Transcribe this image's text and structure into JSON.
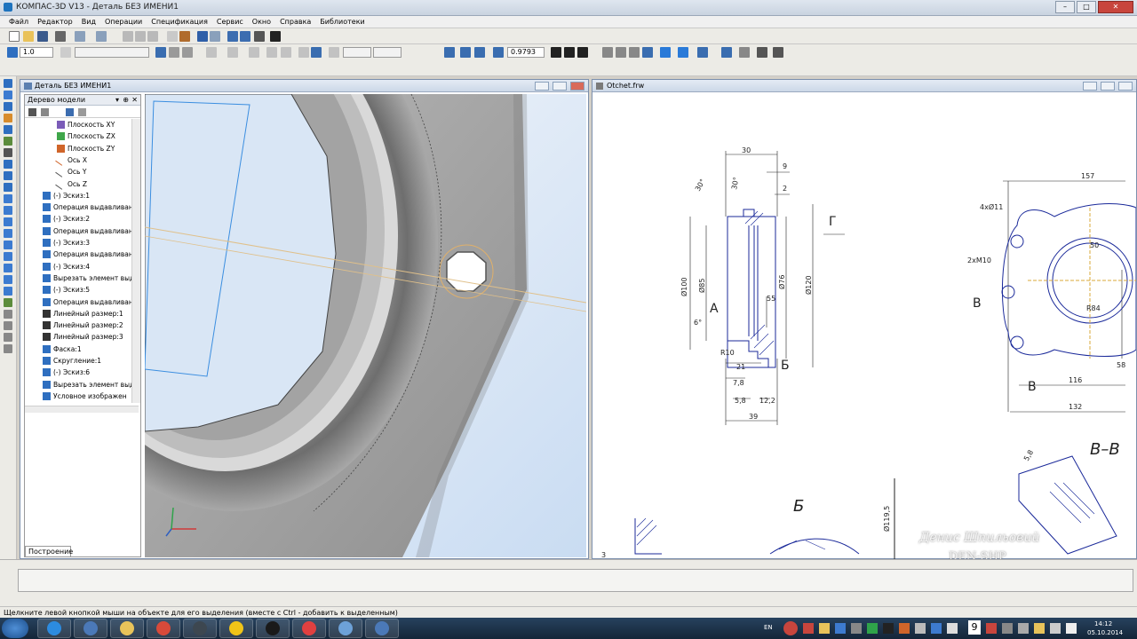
{
  "window": {
    "title": "КОМПАС-3D V13 - Деталь БЕЗ ИМЕНИ1"
  },
  "menu": [
    "Файл",
    "Редактор",
    "Вид",
    "Операции",
    "Спецификация",
    "Сервис",
    "Окно",
    "Справка",
    "Библиотеки"
  ],
  "toolbar": {
    "step_value": "1.0",
    "zoom_value": "0.9793"
  },
  "model_window": {
    "title": "Деталь БЕЗ ИМЕНИ1",
    "tree_title": "Дерево модели",
    "tree_items": [
      {
        "label": "Плоскость XY",
        "icon": "plane-icon",
        "color": "#7b5cb8"
      },
      {
        "label": "Плоскость ZX",
        "icon": "plane-icon",
        "color": "#3fa64a"
      },
      {
        "label": "Плоскость ZY",
        "icon": "plane-icon",
        "color": "#d0652a"
      },
      {
        "label": "Ось X",
        "icon": "axis-icon",
        "color": "#d0652a"
      },
      {
        "label": "Ось Y",
        "icon": "axis-icon",
        "color": "#555555"
      },
      {
        "label": "Ось Z",
        "icon": "axis-icon",
        "color": "#555555"
      },
      {
        "label": "(-) Эскиз:1",
        "icon": "sketch-icon",
        "color": "#2f6fc0"
      },
      {
        "label": "Операция выдавливан",
        "icon": "extrude-icon",
        "color": "#2f6fc0"
      },
      {
        "label": "(-) Эскиз:2",
        "icon": "sketch-icon",
        "color": "#2f6fc0"
      },
      {
        "label": "Операция выдавливан",
        "icon": "extrude-icon",
        "color": "#2f6fc0"
      },
      {
        "label": "(-) Эскиз:3",
        "icon": "sketch-icon",
        "color": "#2f6fc0"
      },
      {
        "label": "Операция выдавливан",
        "icon": "extrude-icon",
        "color": "#2f6fc0"
      },
      {
        "label": "(-) Эскиз:4",
        "icon": "sketch-icon",
        "color": "#2f6fc0"
      },
      {
        "label": "Вырезать элемент выд",
        "icon": "cut-icon",
        "color": "#2f6fc0"
      },
      {
        "label": "(-) Эскиз:5",
        "icon": "sketch-icon",
        "color": "#2f6fc0"
      },
      {
        "label": "Операция выдавливан",
        "icon": "extrude-icon",
        "color": "#2f6fc0"
      },
      {
        "label": "Линейный размер:1",
        "icon": "dimension-icon",
        "color": "#333333"
      },
      {
        "label": "Линейный размер:2",
        "icon": "dimension-icon",
        "color": "#333333"
      },
      {
        "label": "Линейный размер:3",
        "icon": "dimension-icon",
        "color": "#333333"
      },
      {
        "label": "Фаска:1",
        "icon": "chamfer-icon",
        "color": "#2f6fc0"
      },
      {
        "label": "Скругление:1",
        "icon": "fillet-icon",
        "color": "#2f6fc0"
      },
      {
        "label": "(-) Эскиз:6",
        "icon": "sketch-icon",
        "color": "#2f6fc0"
      },
      {
        "label": "Вырезать элемент выд",
        "icon": "cut-icon",
        "color": "#2f6fc0"
      },
      {
        "label": "Условное изображен",
        "icon": "thread-icon",
        "color": "#2f6fc0"
      }
    ],
    "tab_label": "Построение"
  },
  "drawing_window": {
    "title": "Otchet.frw",
    "dims": {
      "d30": "30",
      "d9": "9",
      "d2": "2",
      "d157": "157",
      "a30": "30°",
      "a30b": "30°",
      "phi100": "Ø100",
      "phi85": "Ø85",
      "phi76": "Ø76",
      "phi120": "Ø120",
      "d55": "55",
      "d21": "21",
      "d78": "7,8",
      "d58": "5,8",
      "d122": "12,2",
      "d39": "39",
      "r10": "R10",
      "a6": "6°",
      "holes": "4xØ11",
      "thread": "2xM10",
      "d50": "50",
      "r84": "R84",
      "d58b": "58",
      "d116": "116",
      "d132": "132",
      "phi1195": "Ø119,5",
      "c58": "5,8",
      "sheet": "3"
    },
    "labels": {
      "g": "Г",
      "a": "А",
      "b": "Б",
      "v": "В",
      "v2": "В",
      "section": "В–В",
      "view_b": "Б"
    }
  },
  "status_text": "Щелкните левой кнопкой мыши на объекте для его выделения (вместе с Ctrl - добавить к выделенным)",
  "taskbar": {
    "lang": "EN",
    "time": "14:12",
    "date": "05.10.2014",
    "apps": [
      {
        "icon": "ie-icon",
        "color": "#2c8be0"
      },
      {
        "icon": "kompas-icon",
        "color": "#4b79b8"
      },
      {
        "icon": "folder-icon",
        "color": "#e8c35a"
      },
      {
        "icon": "chrome-icon",
        "color": "#d84a3a"
      },
      {
        "icon": "app-w-icon",
        "color": "#3d4750"
      },
      {
        "icon": "norton-icon",
        "color": "#f0c418"
      },
      {
        "icon": "steam-icon",
        "color": "#1a1a1a"
      },
      {
        "icon": "opera-icon",
        "color": "#e04040"
      },
      {
        "icon": "monitor-icon",
        "color": "#6da1d8"
      },
      {
        "icon": "kompas2-icon",
        "color": "#4b79b8"
      }
    ]
  },
  "watermark": {
    "author": "Денис Шпильовий",
    "brand": "DEN-SHP"
  }
}
